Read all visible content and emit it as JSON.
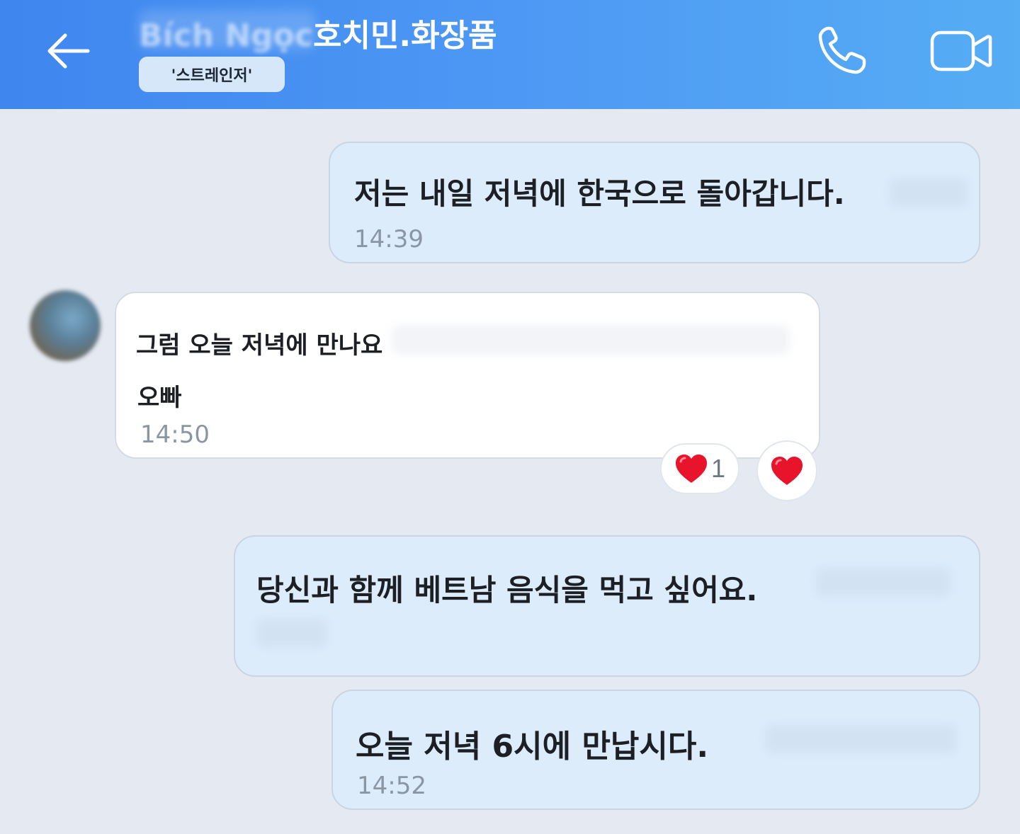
{
  "header": {
    "title_prefix": "Bích Ngọc",
    "title": "호치민.화장품",
    "tag": "'스트레인저'",
    "icons": {
      "back": "arrow-left-icon",
      "call": "phone-icon",
      "video": "video-camera-icon"
    }
  },
  "messages": [
    {
      "direction": "sent",
      "text": "저는 내일 저녁에 한국으로 돌아갑니다.",
      "time": "14:39"
    },
    {
      "direction": "received",
      "line1": "그럼 오늘 저녁에 만나요",
      "line2": "오빠",
      "time": "14:50",
      "reaction": {
        "emoji": "❤️",
        "count": "1"
      }
    },
    {
      "direction": "sent",
      "text": "당신과 함께 베트남 음식을 먹고 싶어요."
    },
    {
      "direction": "sent",
      "text": "오늘 저녁 6시에 만납시다.",
      "time": "14:52"
    }
  ],
  "colors": {
    "header_start": "#3f86ef",
    "header_end": "#56adf4",
    "sent_bubble": "#dcecfb",
    "received_bubble": "#ffffff",
    "background": "#e5e9f2",
    "heart": "#e8142c"
  }
}
